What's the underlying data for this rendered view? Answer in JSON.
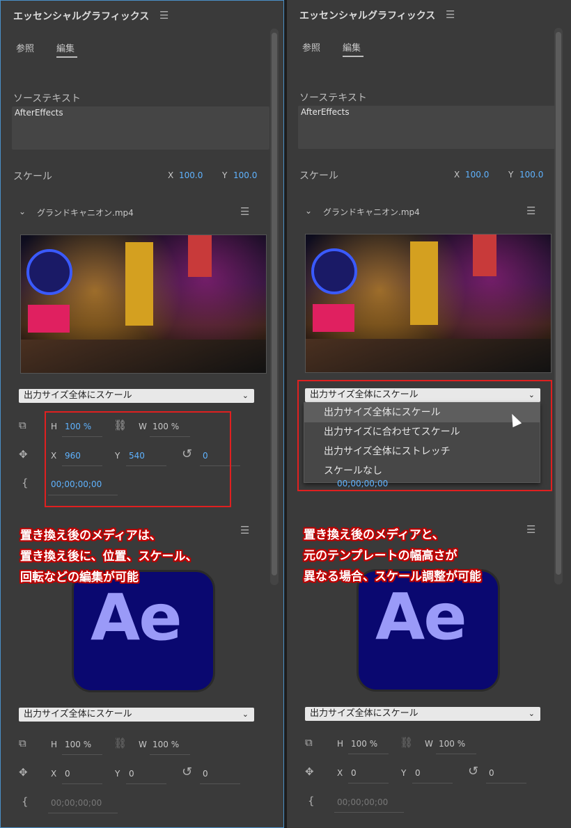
{
  "panel": {
    "title": "エッセンシャルグラフィックス",
    "tabs": [
      "参照",
      "編集"
    ],
    "source_text_label": "ソーステキスト",
    "source_text_value": "AfterEffects",
    "scale_label": "スケール",
    "scale_x_label": "X",
    "scale_x_value": "100.0",
    "scale_y_label": "Y",
    "scale_y_value": "100.0",
    "media_name": "グランドキャニオン.mp4",
    "dropdown_value": "出力サイズ全体にスケール",
    "tc_placeholder": "00;00;00;00",
    "ae_text": "Ae"
  },
  "left_props1": {
    "h_label": "H",
    "h_value": "100 %",
    "w_label": "W",
    "w_value": "100 %",
    "x_label": "X",
    "x_value": "960",
    "y_label": "Y",
    "y_value": "540",
    "rot_value": "0",
    "tc_value": "00;00;00;00"
  },
  "right_props1": {
    "tc_value": "00;00;00;00"
  },
  "props2": {
    "h_label": "H",
    "h_value": "100 %",
    "w_label": "W",
    "w_value": "100 %",
    "x_label": "X",
    "x_value": "0",
    "y_label": "Y",
    "y_value": "0",
    "rot_value": "0",
    "tc_value": "00;00;00;00"
  },
  "menu": {
    "items": [
      "出力サイズ全体にスケール",
      "出力サイズに合わせてスケール",
      "出力サイズ全体にストレッチ",
      "スケールなし"
    ]
  },
  "captions": {
    "left": [
      "置き換え後のメディアは、",
      "置き換え後に、位置、スケール、",
      "回転などの編集が可能"
    ],
    "right": [
      "置き換え後のメディアと、",
      "元のテンプレートの幅高さが",
      "異なる場合、スケール調整が可能"
    ]
  },
  "colors": {
    "accent_blue": "#5fb3ff",
    "highlight_red": "#e02020",
    "panel_bg": "#3a3a3a",
    "ae_bg": "#0a0870",
    "ae_fg": "#9a9af8"
  }
}
